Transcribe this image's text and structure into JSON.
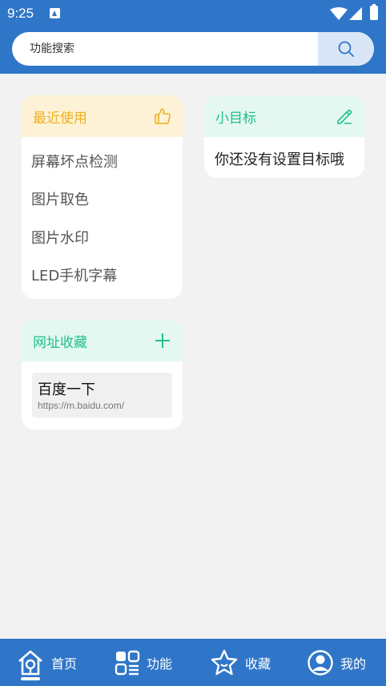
{
  "status_bar": {
    "time": "9:25"
  },
  "search": {
    "placeholder": "功能搜索"
  },
  "recent": {
    "title": "最近使用",
    "items": [
      "屏幕坏点检测",
      "图片取色",
      "图片水印",
      "LED手机字幕"
    ]
  },
  "goal": {
    "title": "小目标",
    "empty_text": "你还没有设置目标哦"
  },
  "favorites": {
    "title": "网址收藏",
    "sites": [
      {
        "title": "百度一下",
        "url": "https://m.baidu.com/"
      }
    ]
  },
  "bottom_nav": [
    "首页",
    "功能",
    "收藏",
    "我的"
  ],
  "colors": {
    "primary": "#2f76c8",
    "recent_accent": "#f0b020",
    "goal_accent": "#1fbf8e"
  }
}
